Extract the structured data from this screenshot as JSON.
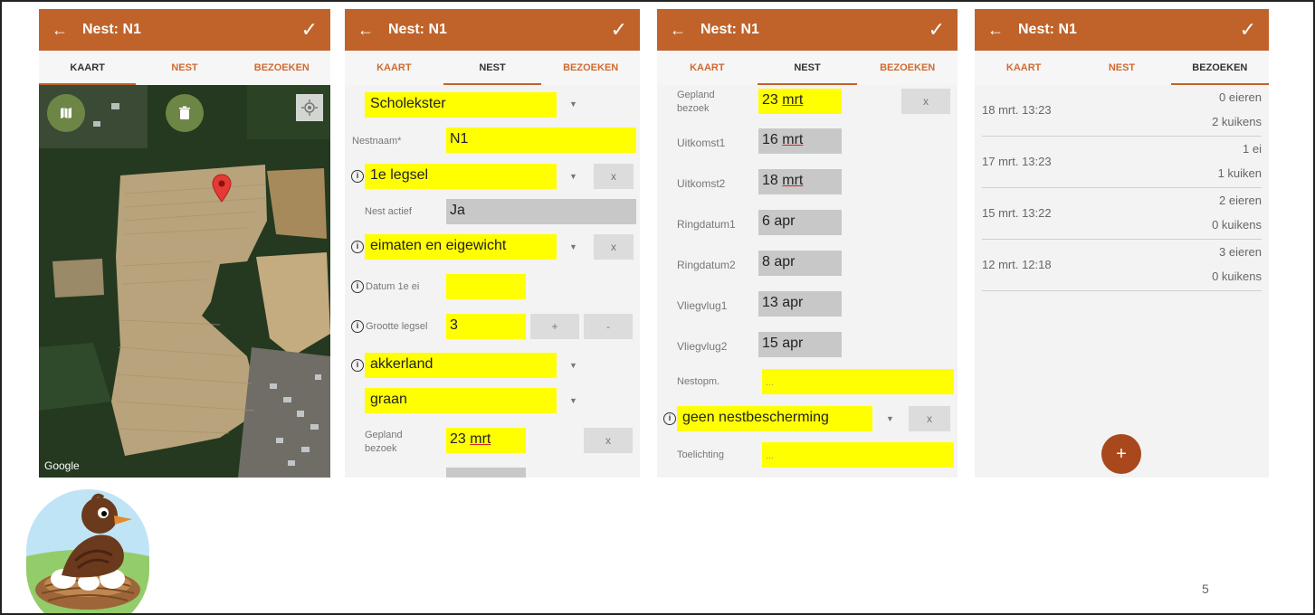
{
  "slide": {
    "page_number": "5"
  },
  "app": {
    "title": "Nest: N1",
    "tabs": [
      "KAART",
      "NEST",
      "BEZOEKEN"
    ],
    "colors": {
      "appbar": "#c0632a",
      "highlight": "#ffff00",
      "fab": "#a8481c"
    }
  },
  "map_screen": {
    "google_label": "Google",
    "icons": [
      "map-icon",
      "trash-icon",
      "locate-icon",
      "pin-icon"
    ]
  },
  "nest_screen": {
    "species": "Scholekster",
    "nestnaam_label": "Nestnaam*",
    "nestnaam_value": "N1",
    "legsel": "1e legsel",
    "x_label": "x",
    "actief_label": "Nest actief",
    "actief_value": "Ja",
    "metingen": "eimaten en eigewicht",
    "datum_label": "Datum 1e ei",
    "datum_value": "",
    "grootte_label": "Grootte legsel",
    "grootte_value": "3",
    "plus": "+",
    "minus": "-",
    "habitat": "akkerland",
    "gewas": "graan",
    "gepland_label": "Gepland bezoek",
    "gepland_value_day": "23",
    "gepland_value_month": "mrt"
  },
  "details_screen": {
    "gepland_label": "Gepland bezoek",
    "gepland_day": "23",
    "gepland_month": "mrt",
    "x_label": "x",
    "rows": [
      {
        "label": "Uitkomst1",
        "day": "16",
        "month": "mrt",
        "underline": true
      },
      {
        "label": "Uitkomst2",
        "day": "18",
        "month": "mrt",
        "underline": true
      },
      {
        "label": "Ringdatum1",
        "day": "6",
        "month": "apr",
        "underline": false
      },
      {
        "label": "Ringdatum2",
        "day": "8",
        "month": "apr",
        "underline": false
      },
      {
        "label": "Vliegvlug1",
        "day": "13",
        "month": "apr",
        "underline": false
      },
      {
        "label": "Vliegvlug2",
        "day": "15",
        "month": "apr",
        "underline": false
      }
    ],
    "nestopm_label": "Nestopm.",
    "nestopm_value": "...",
    "bescherming": "geen nestbescherming",
    "toelichting_label": "Toelichting",
    "toelichting_value": "..."
  },
  "visits_screen": {
    "visits": [
      {
        "date": "18 mrt. 13:23",
        "eggs": "0 eieren",
        "chicks": "2 kuikens"
      },
      {
        "date": "17 mrt. 13:23",
        "eggs": "1 ei",
        "chicks": "1 kuiken"
      },
      {
        "date": "15 mrt. 13:22",
        "eggs": "2 eieren",
        "chicks": "0 kuikens"
      },
      {
        "date": "12 mrt. 12:18",
        "eggs": "3 eieren",
        "chicks": "0 kuikens"
      }
    ],
    "fab_label": "+"
  }
}
